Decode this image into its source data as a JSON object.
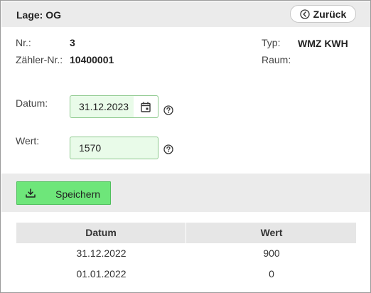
{
  "header": {
    "title": "Lage: OG",
    "back_label": "Zurück"
  },
  "info": {
    "nr_label": "Nr.:",
    "nr_value": "3",
    "zaehler_label": "Zähler-Nr.:",
    "zaehler_value": "10400001",
    "typ_label": "Typ:",
    "typ_value": "WMZ KWH",
    "raum_label": "Raum:",
    "raum_value": ""
  },
  "form": {
    "datum_label": "Datum:",
    "datum_value": "31.12.2023",
    "wert_label": "Wert:",
    "wert_value": "1570"
  },
  "save": {
    "label": "Speichern"
  },
  "table": {
    "headers": [
      "Datum",
      "Wert"
    ],
    "rows": [
      [
        "31.12.2022",
        "900"
      ],
      [
        "01.01.2022",
        "0"
      ]
    ]
  },
  "colors": {
    "save_button": "#6ee67a",
    "field_background": "#e9fbe9",
    "header_background": "#ebebeb"
  },
  "icons": {
    "back": "circle-chevron-left-icon",
    "calendar": "calendar-icon",
    "help": "question-circle-icon",
    "save": "download-tray-icon"
  }
}
